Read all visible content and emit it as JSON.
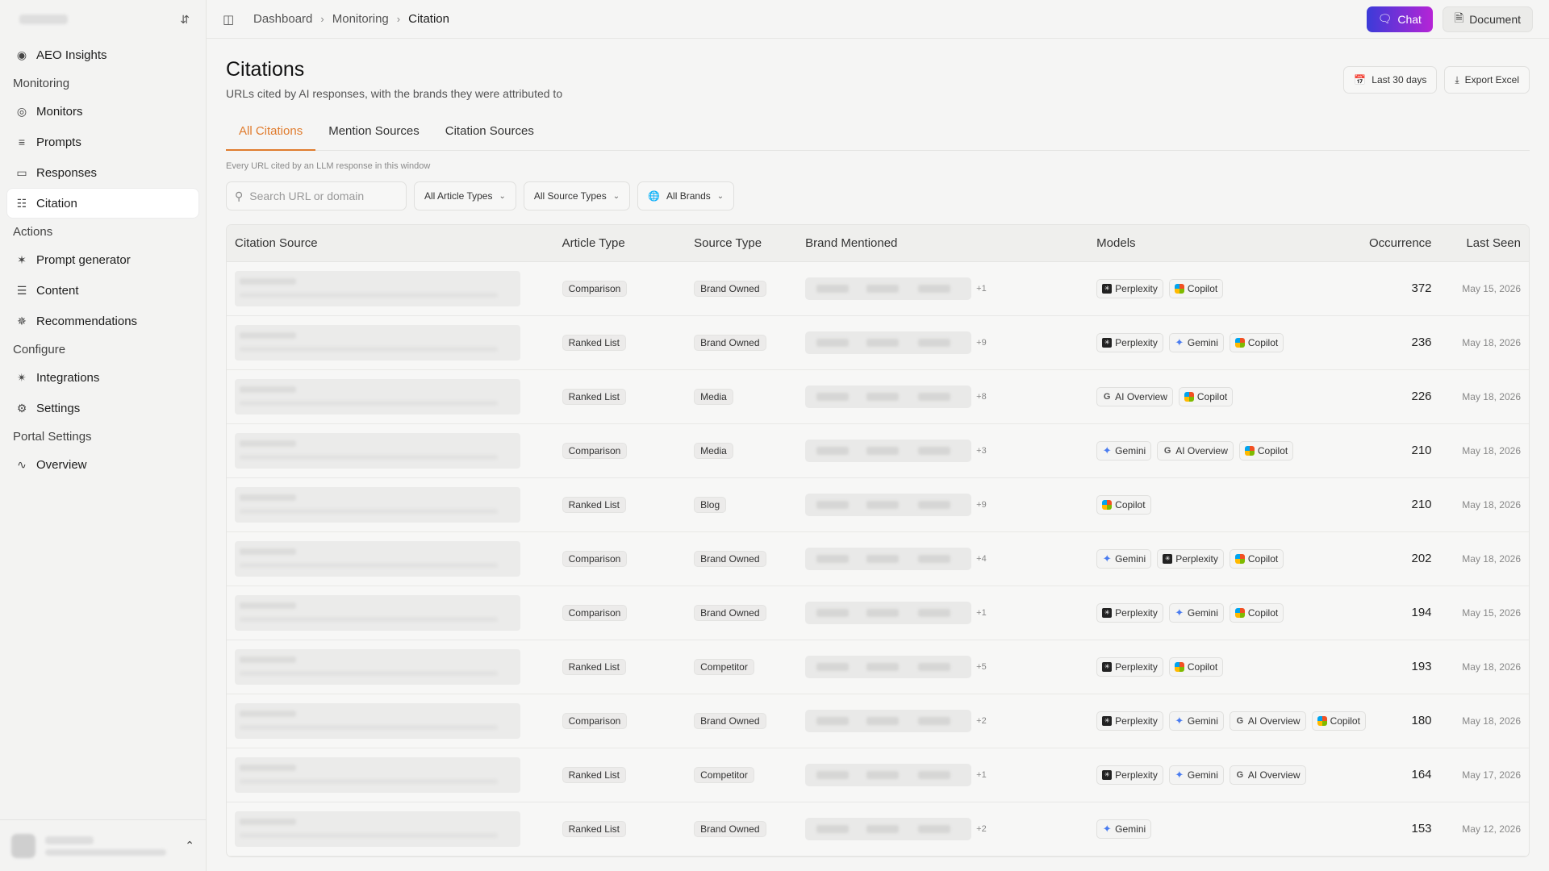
{
  "sidebar": {
    "items_top": [
      {
        "label": "AEO Insights",
        "icon": "eye-icon"
      }
    ],
    "groups": [
      {
        "label": "Monitoring",
        "items": [
          {
            "label": "Monitors",
            "icon": "globe-icon"
          },
          {
            "label": "Prompts",
            "icon": "list-icon"
          },
          {
            "label": "Responses",
            "icon": "monitor-icon"
          },
          {
            "label": "Citation",
            "icon": "book-icon",
            "active": true
          }
        ]
      },
      {
        "label": "Actions",
        "items": [
          {
            "label": "Prompt generator",
            "icon": "wand-icon"
          },
          {
            "label": "Content",
            "icon": "document-icon"
          },
          {
            "label": "Recommendations",
            "icon": "sparkle-icon"
          }
        ]
      },
      {
        "label": "Configure",
        "items": [
          {
            "label": "Integrations",
            "icon": "plug-icon"
          },
          {
            "label": "Settings",
            "icon": "gear-icon"
          }
        ]
      },
      {
        "label": "Portal Settings",
        "items": [
          {
            "label": "Overview",
            "icon": "activity-icon"
          }
        ]
      }
    ]
  },
  "topbar": {
    "breadcrumbs": [
      "Dashboard",
      "Monitoring",
      "Citation"
    ],
    "chat_label": "Chat",
    "document_label": "Document"
  },
  "page": {
    "title": "Citations",
    "subtitle": "URLs cited by AI responses, with the brands they were attributed to",
    "date_range_label": "Last 30 days",
    "export_label": "Export Excel",
    "tabs": [
      {
        "label": "All Citations",
        "active": true
      },
      {
        "label": "Mention Sources"
      },
      {
        "label": "Citation Sources"
      }
    ],
    "tab_description": "Every URL cited by an LLM response in this window"
  },
  "filters": {
    "search_placeholder": "Search URL or domain",
    "article_types": "All Article Types",
    "source_types": "All Source Types",
    "brands": "All Brands"
  },
  "table": {
    "headers": [
      "Citation Source",
      "Article Type",
      "Source Type",
      "Brand Mentioned",
      "Models",
      "Occurrence",
      "Last Seen"
    ],
    "rows": [
      {
        "article": "Comparison",
        "source": "Brand Owned",
        "plus": "+1",
        "models": [
          "Perplexity",
          "Copilot"
        ],
        "occurrence": "372",
        "last_seen": "May 15, 2026"
      },
      {
        "article": "Ranked List",
        "source": "Brand Owned",
        "plus": "+9",
        "models": [
          "Perplexity",
          "Gemini",
          "Copilot"
        ],
        "occurrence": "236",
        "last_seen": "May 18, 2026"
      },
      {
        "article": "Ranked List",
        "source": "Media",
        "plus": "+8",
        "models": [
          "AI Overview",
          "Copilot"
        ],
        "occurrence": "226",
        "last_seen": "May 18, 2026"
      },
      {
        "article": "Comparison",
        "source": "Media",
        "plus": "+3",
        "models": [
          "Gemini",
          "AI Overview",
          "Copilot"
        ],
        "occurrence": "210",
        "last_seen": "May 18, 2026"
      },
      {
        "article": "Ranked List",
        "source": "Blog",
        "plus": "+9",
        "models": [
          "Copilot"
        ],
        "occurrence": "210",
        "last_seen": "May 18, 2026"
      },
      {
        "article": "Comparison",
        "source": "Brand Owned",
        "plus": "+4",
        "models": [
          "Gemini",
          "Perplexity",
          "Copilot"
        ],
        "occurrence": "202",
        "last_seen": "May 18, 2026"
      },
      {
        "article": "Comparison",
        "source": "Brand Owned",
        "plus": "+1",
        "models": [
          "Perplexity",
          "Gemini",
          "Copilot"
        ],
        "occurrence": "194",
        "last_seen": "May 15, 2026"
      },
      {
        "article": "Ranked List",
        "source": "Competitor",
        "plus": "+5",
        "models": [
          "Perplexity",
          "Copilot"
        ],
        "occurrence": "193",
        "last_seen": "May 18, 2026"
      },
      {
        "article": "Comparison",
        "source": "Brand Owned",
        "plus": "+2",
        "models": [
          "Perplexity",
          "Gemini",
          "AI Overview",
          "Copilot"
        ],
        "occurrence": "180",
        "last_seen": "May 18, 2026"
      },
      {
        "article": "Ranked List",
        "source": "Competitor",
        "plus": "+1",
        "models": [
          "Perplexity",
          "Gemini",
          "AI Overview"
        ],
        "occurrence": "164",
        "last_seen": "May 17, 2026"
      },
      {
        "article": "Ranked List",
        "source": "Brand Owned",
        "plus": "+2",
        "models": [
          "Gemini"
        ],
        "occurrence": "153",
        "last_seen": "May 12, 2026"
      }
    ]
  }
}
